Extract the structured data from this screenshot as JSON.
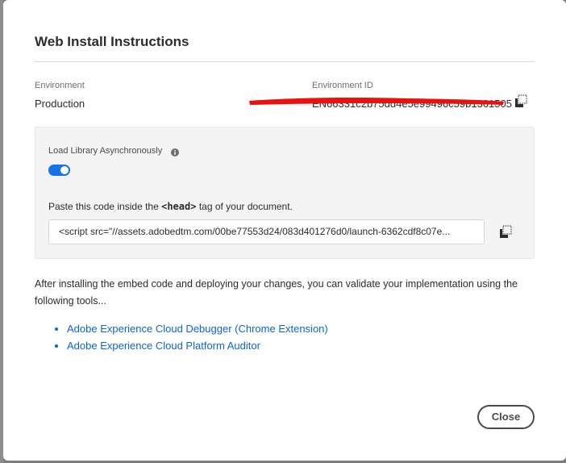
{
  "dialog": {
    "title": "Web Install Instructions"
  },
  "environment": {
    "label": "Environment",
    "value": "Production"
  },
  "environment_id": {
    "label": "Environment ID",
    "value": "EN66331c2b75dd4e5e99496c59b1361505"
  },
  "panel": {
    "async_label": "Load Library Asynchronously",
    "async_enabled": true,
    "paste_prefix": "Paste this code inside the",
    "paste_tag": "<head>",
    "paste_suffix": "tag of your document.",
    "code_value": "<script src=\"//assets.adobedtm.com/00be77553d24/083d401276d0/launch-6362cdf8c07e..."
  },
  "after_text": "After installing the embed code and deploying your changes, you can validate your implementation using the following tools...",
  "tools": [
    {
      "label": "Adobe Experience Cloud Debugger (Chrome Extension)"
    },
    {
      "label": "Adobe Experience Cloud Platform Auditor"
    }
  ],
  "close_label": "Close",
  "colors": {
    "accent": "#1473e6",
    "link": "#0d66d0",
    "redaction": "#e8130f"
  },
  "icons": {
    "copy": "copy-icon",
    "info": "info-icon"
  }
}
